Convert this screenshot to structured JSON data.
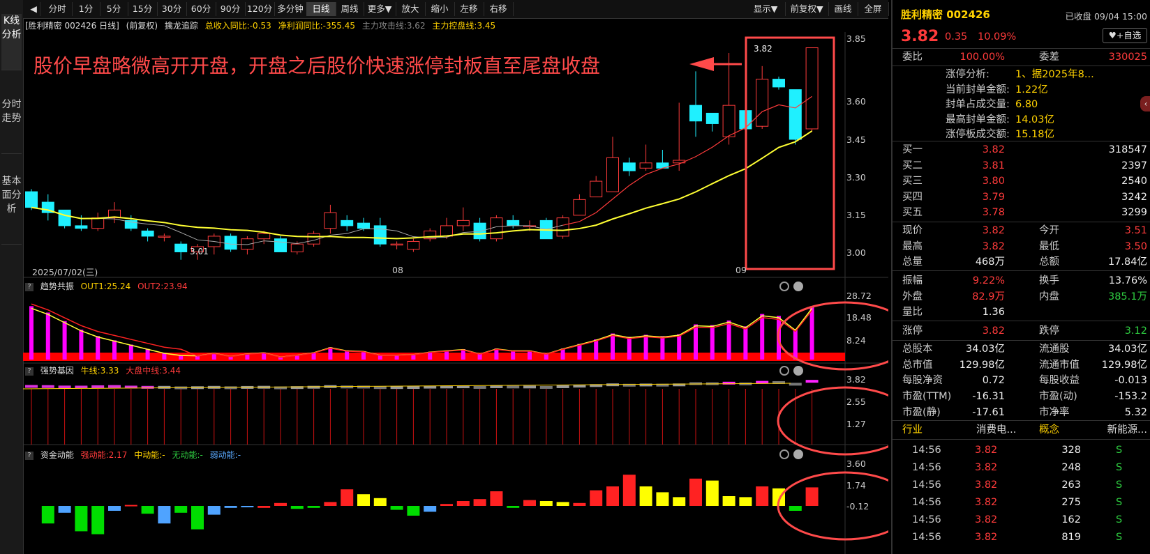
{
  "sidebar": {
    "tabs": [
      "K线分析",
      "分时走势",
      "基本面分析"
    ]
  },
  "toolbar": {
    "left_items": [
      "分时",
      "1分",
      "5分",
      "15分",
      "30分",
      "60分",
      "90分",
      "120分",
      "多分钟",
      "日线",
      "周线",
      "更多▼",
      "放大",
      "缩小",
      "左移",
      "右移"
    ],
    "right_items": [
      "显示▼",
      "前复权▼",
      "画线",
      "全屏"
    ],
    "active": "日线"
  },
  "infobar": {
    "stock": "[胜利精密 002426 日线]",
    "adj": "(前复权)",
    "indicator": "擒龙追踪",
    "rev": "总收入同比:-0.53",
    "profit": "净利润同比:-355.45",
    "attack": "主力攻击线:3.62",
    "control": "主力控盘线:3.45"
  },
  "annotation": "股价早盘略微高开开盘，开盘之后股价快速涨停封板直至尾盘收盘",
  "main_chart": {
    "yticks": [
      "3.85",
      "3.60",
      "3.45",
      "3.30",
      "3.15",
      "3.00"
    ],
    "xlabels": [
      "2025/07/02(三)",
      "08",
      "09"
    ],
    "high_label": "3.82",
    "low_label": "3.01"
  },
  "panel1": {
    "title": "趋势共振",
    "out1": "OUT1:25.24",
    "out2": "OUT2:23.94",
    "yticks": [
      "28.72",
      "18.48",
      "8.24"
    ]
  },
  "panel2": {
    "title": "强势基因",
    "l1": "牛线:3.33",
    "l2": "大盘中线:3.44",
    "yticks": [
      "3.82",
      "2.55",
      "1.27"
    ]
  },
  "panel3": {
    "title": "资金动能",
    "s": "强动能:2.17",
    "m": "中动能:-",
    "w": "无动能:-",
    "r": "弱动能:-",
    "yticks": [
      "3.60",
      "1.74",
      "-0.12"
    ]
  },
  "chart_data": {
    "type": "candlestick",
    "note_series": "daily OHLC, prices in CNY",
    "ylim": [
      2.98,
      3.88
    ],
    "candles": [
      [
        3.27,
        3.21,
        3.28,
        3.2
      ],
      [
        3.23,
        3.19,
        3.26,
        3.16
      ],
      [
        3.2,
        3.14,
        3.2,
        3.13
      ],
      [
        3.14,
        3.13,
        3.18,
        3.12
      ],
      [
        3.13,
        3.17,
        3.19,
        3.12
      ],
      [
        3.17,
        3.2,
        3.23,
        3.15
      ],
      [
        3.16,
        3.13,
        3.18,
        3.12
      ],
      [
        3.12,
        3.1,
        3.13,
        3.08
      ],
      [
        3.1,
        3.1,
        3.11,
        3.08
      ],
      [
        3.07,
        3.04,
        3.08,
        3.01
      ],
      [
        3.04,
        3.06,
        3.07,
        3.01
      ],
      [
        3.06,
        3.1,
        3.11,
        3.03
      ],
      [
        3.1,
        3.05,
        3.11,
        3.04
      ],
      [
        3.05,
        3.09,
        3.1,
        3.03
      ],
      [
        3.09,
        3.11,
        3.12,
        3.07
      ],
      [
        3.09,
        3.04,
        3.1,
        3.04
      ],
      [
        3.04,
        3.07,
        3.08,
        3.03
      ],
      [
        3.07,
        3.11,
        3.12,
        3.06
      ],
      [
        3.13,
        3.19,
        3.22,
        3.11
      ],
      [
        3.16,
        3.14,
        3.18,
        3.12
      ],
      [
        3.15,
        3.13,
        3.17,
        3.12
      ],
      [
        3.14,
        3.07,
        3.17,
        3.06
      ],
      [
        3.07,
        3.07,
        3.08,
        3.05
      ],
      [
        3.05,
        3.08,
        3.09,
        3.04
      ],
      [
        3.09,
        3.12,
        3.13,
        3.08
      ],
      [
        3.1,
        3.14,
        3.17,
        3.09
      ],
      [
        3.14,
        3.16,
        3.21,
        3.12
      ],
      [
        3.15,
        3.09,
        3.17,
        3.08
      ],
      [
        3.09,
        3.17,
        3.18,
        3.08
      ],
      [
        3.16,
        3.14,
        3.18,
        3.13
      ],
      [
        3.14,
        3.14,
        3.16,
        3.12
      ],
      [
        3.16,
        3.09,
        3.17,
        3.09
      ],
      [
        3.1,
        3.17,
        3.18,
        3.09
      ],
      [
        3.18,
        3.24,
        3.26,
        3.18
      ],
      [
        3.25,
        3.31,
        3.33,
        3.25
      ],
      [
        3.27,
        3.4,
        3.48,
        3.27
      ],
      [
        3.38,
        3.35,
        3.4,
        3.33
      ],
      [
        3.36,
        3.38,
        3.45,
        3.35
      ],
      [
        3.38,
        3.36,
        3.43,
        3.36
      ],
      [
        3.38,
        3.39,
        3.61,
        3.35
      ],
      [
        3.6,
        3.54,
        3.73,
        3.48
      ],
      [
        3.57,
        3.53,
        3.57,
        3.5
      ],
      [
        3.48,
        3.6,
        3.8,
        3.45
      ],
      [
        3.58,
        3.51,
        3.61,
        3.51
      ],
      [
        3.52,
        3.7,
        3.75,
        3.51
      ],
      [
        3.7,
        3.67,
        3.71,
        3.66
      ],
      [
        3.66,
        3.47,
        3.66,
        3.45
      ],
      [
        3.51,
        3.82,
        3.82,
        3.5
      ]
    ],
    "ma_yellow_last": 3.45
  },
  "right": {
    "name": "胜利精密 002426",
    "status": "已收盘 09/04 15:00",
    "price": "3.82",
    "chg": "0.35",
    "pct": "10.09%",
    "fav": "+自选",
    "weibi_l": "委比",
    "weibi": "100.00%",
    "weicha_l": "委差",
    "weicha": "330025",
    "limit_lines": [
      {
        "k": "涨停分析:",
        "v": "1、据2025年8..."
      },
      {
        "k": "当前封单金额:",
        "v": "1.22亿"
      },
      {
        "k": "封单占成交量:",
        "v": "6.80"
      },
      {
        "k": "最高封单金额:",
        "v": "14.03亿"
      },
      {
        "k": "涨停板成交额:",
        "v": "15.18亿"
      }
    ],
    "bids": [
      {
        "k": "买一",
        "p": "3.82",
        "v": "318547"
      },
      {
        "k": "买二",
        "p": "3.81",
        "v": "2397"
      },
      {
        "k": "买三",
        "p": "3.80",
        "v": "2540"
      },
      {
        "k": "买四",
        "p": "3.79",
        "v": "3242"
      },
      {
        "k": "买五",
        "p": "3.78",
        "v": "3299"
      }
    ],
    "stats": [
      {
        "a": "现价",
        "b": "3.82",
        "bc": "red",
        "c": "今开",
        "d": "3.51",
        "dc": "red"
      },
      {
        "a": "最高",
        "b": "3.82",
        "bc": "red",
        "c": "最低",
        "d": "3.50",
        "dc": "red"
      },
      {
        "a": "总量",
        "b": "468万",
        "bc": "white",
        "c": "总额",
        "d": "17.84亿",
        "dc": "white"
      }
    ],
    "stats2": [
      {
        "a": "振幅",
        "b": "9.22%",
        "bc": "red",
        "c": "换手",
        "d": "13.76%",
        "dc": "white"
      },
      {
        "a": "外盘",
        "b": "82.9万",
        "bc": "red",
        "c": "内盘",
        "d": "385.1万",
        "dc": "green"
      },
      {
        "a": "量比",
        "b": "1.36",
        "bc": "white",
        "c": "",
        "d": "",
        "dc": "white"
      }
    ],
    "stats3": [
      {
        "a": "涨停",
        "b": "3.82",
        "bc": "red",
        "c": "跌停",
        "d": "3.12",
        "dc": "green"
      }
    ],
    "stats4": [
      {
        "a": "总股本",
        "b": "34.03亿",
        "bc": "white",
        "c": "流通股",
        "d": "34.03亿",
        "dc": "white"
      },
      {
        "a": "总市值",
        "b": "129.98亿",
        "bc": "white",
        "c": "流通市值",
        "d": "129.98亿",
        "dc": "white"
      },
      {
        "a": "每股净资",
        "b": "0.72",
        "bc": "white",
        "c": "每股收益",
        "d": "-0.013",
        "dc": "white"
      },
      {
        "a": "市盈(TTM)",
        "b": "-16.31",
        "bc": "white",
        "c": "市盈(动)",
        "d": "-153.2",
        "dc": "white"
      },
      {
        "a": "市盈(静)",
        "b": "-17.61",
        "bc": "white",
        "c": "市净率",
        "d": "5.32",
        "dc": "white"
      }
    ],
    "industry_l": "行业",
    "industry": "消费电...",
    "concept_l": "概念",
    "concept": "新能源...",
    "ticks": [
      {
        "t": "14:56",
        "p": "3.82",
        "v": "328",
        "s": "S"
      },
      {
        "t": "14:56",
        "p": "3.82",
        "v": "248",
        "s": "S"
      },
      {
        "t": "14:56",
        "p": "3.82",
        "v": "263",
        "s": "S"
      },
      {
        "t": "14:56",
        "p": "3.82",
        "v": "275",
        "s": "S"
      },
      {
        "t": "14:56",
        "p": "3.82",
        "v": "162",
        "s": "S"
      },
      {
        "t": "14:56",
        "p": "3.82",
        "v": "819",
        "s": "S"
      }
    ]
  }
}
